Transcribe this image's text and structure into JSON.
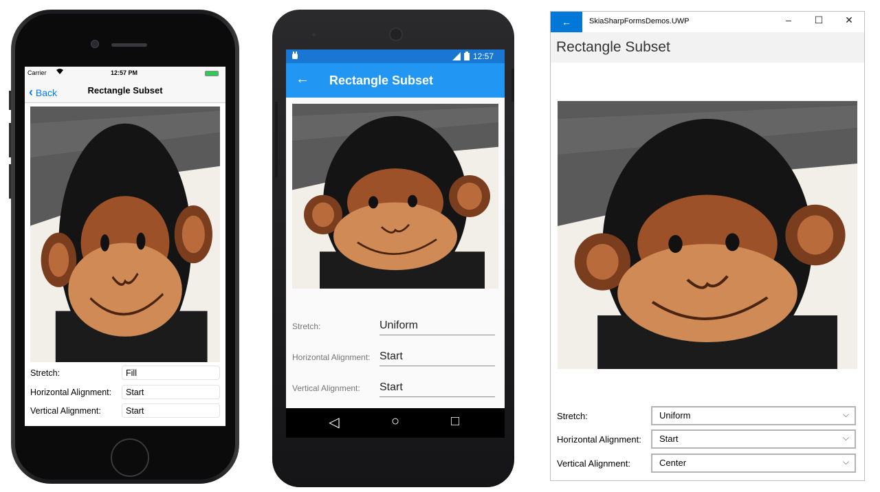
{
  "ios": {
    "carrier": "Carrier",
    "time": "12:57 PM",
    "back_label": "Back",
    "title": "Rectangle Subset",
    "rows": [
      {
        "label": "Stretch:",
        "value": "Fill"
      },
      {
        "label": "Horizontal Alignment:",
        "value": "Start"
      },
      {
        "label": "Vertical Alignment:",
        "value": "Start"
      }
    ]
  },
  "android": {
    "time": "12:57",
    "back_icon": "←",
    "title": "Rectangle Subset",
    "rows": [
      {
        "label": "Stretch:",
        "value": "Uniform"
      },
      {
        "label": "Horizontal Alignment:",
        "value": "Start"
      },
      {
        "label": "Vertical Alignment:",
        "value": "Start"
      }
    ],
    "nav": {
      "back": "◁",
      "home": "○",
      "recents": "□"
    }
  },
  "uwp": {
    "app_title": "SkiaSharpFormsDemos.UWP",
    "back_icon": "←",
    "minimize": "–",
    "maximize": "☐",
    "close": "✕",
    "page_title": "Rectangle Subset",
    "rows": [
      {
        "label": "Stretch:",
        "value": "Uniform"
      },
      {
        "label": "Horizontal Alignment:",
        "value": "Start"
      },
      {
        "label": "Vertical Alignment:",
        "value": "Center"
      }
    ],
    "chevron": "⌵"
  },
  "colors": {
    "ios_accent": "#007aff",
    "android_primary": "#2196f3",
    "android_status": "#1976d2",
    "uwp_accent": "#0078d7"
  }
}
